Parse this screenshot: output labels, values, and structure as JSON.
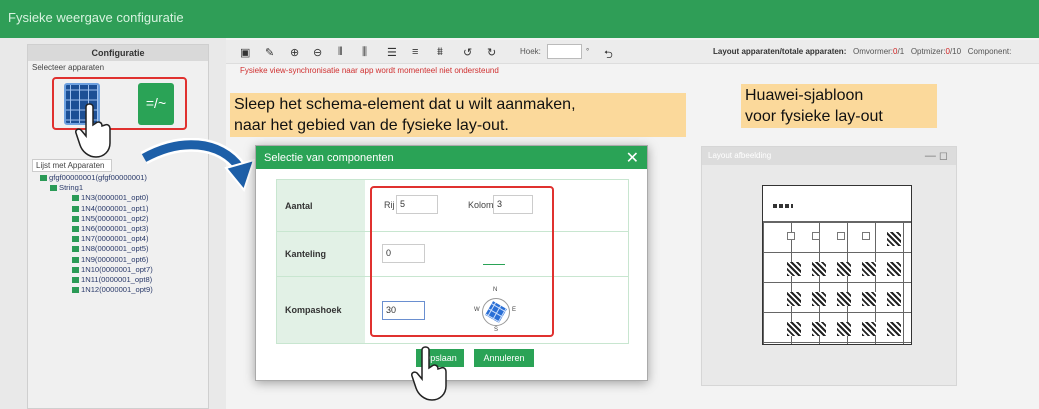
{
  "window_title": "Fysieke weergave configuratie",
  "left_panel": {
    "title": "Configuratie",
    "select_label": "Selecteer apparaten",
    "inverter_glyph": "=/~",
    "device_list_label": "Lijst met Apparaten",
    "tree": [
      {
        "level": 1,
        "label": "gfgf00000001(gfgf00000001)"
      },
      {
        "level": 2,
        "label": "String1"
      },
      {
        "level": 3,
        "label": "1N3(0000001_opt0)"
      },
      {
        "level": 3,
        "label": "1N4(0000001_opt1)"
      },
      {
        "level": 3,
        "label": "1N5(0000001_opt2)"
      },
      {
        "level": 3,
        "label": "1N6(0000001_opt3)"
      },
      {
        "level": 3,
        "label": "1N7(0000001_opt4)"
      },
      {
        "level": 3,
        "label": "1N8(0000001_opt5)"
      },
      {
        "level": 3,
        "label": "1N9(0000001_opt6)"
      },
      {
        "level": 3,
        "label": "1N10(0000001_opt7)"
      },
      {
        "level": 3,
        "label": "1N11(0000001_opt8)"
      },
      {
        "level": 3,
        "label": "1N12(0000001_opt9)"
      }
    ]
  },
  "toolbar": {
    "angle_label": "Hoek:",
    "degree_symbol": "°",
    "warning": "Fysieke view-synchronisatie naar app wordt momenteel niet ondersteund"
  },
  "stats": {
    "label": "Layout apparaten/totale apparaten:",
    "omvormer_label": "Omvormer:",
    "omvormer_used": "0",
    "omvormer_total": "/1",
    "optimizer_label": "Optmizer:",
    "optimizer_used": "0",
    "optimizer_total": "/10",
    "component_label": "Component:"
  },
  "callouts": {
    "drag_instruction_line1": "Sleep het schema-element dat u wilt aanmaken,",
    "drag_instruction_line2": "naar het gebied van de fysieke lay-out.",
    "template_line1": "Huawei-sjabloon",
    "template_line2": "voor fysieke lay-out"
  },
  "layout_panel": {
    "title": "Layout afbeelding"
  },
  "modal": {
    "title": "Selectie van componenten",
    "fields": {
      "aantal_label": "Aantal",
      "rij_label": "Rij",
      "rij_value": "5",
      "kolom_label": "Kolom",
      "kolom_value": "3",
      "kanteling_label": "Kanteling",
      "kanteling_value": "0",
      "kompashoek_label": "Kompashoek",
      "kompashoek_value": "30"
    },
    "compass": {
      "n": "N",
      "e": "E",
      "s": "S",
      "w": "W"
    },
    "ok_label": "Opslaan",
    "cancel_label": "Annuleren"
  },
  "colors": {
    "brand": "#2aa356",
    "header": "#2f9e57",
    "highlight": "#e0312f",
    "callout": "#fbd99b"
  }
}
